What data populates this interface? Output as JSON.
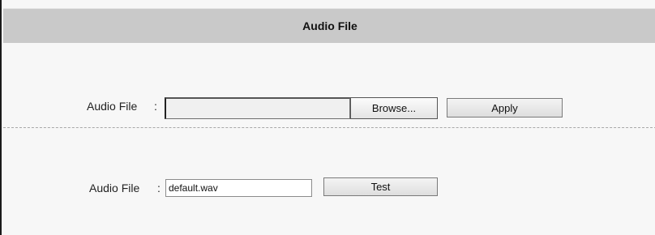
{
  "header": {
    "title": "Audio File"
  },
  "upload": {
    "label": "Audio File",
    "separator": ":",
    "file_value": "",
    "browse_label": "Browse...",
    "apply_label": "Apply"
  },
  "current": {
    "label": "Audio File",
    "separator": ":",
    "value": "default.wav",
    "test_label": "Test"
  }
}
